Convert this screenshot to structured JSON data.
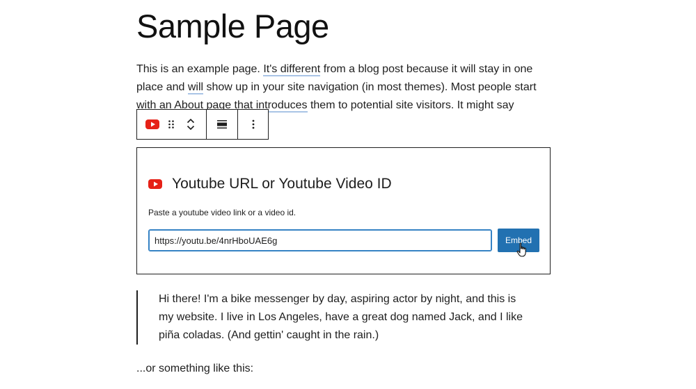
{
  "page": {
    "title": "Sample Page",
    "intro_lines": [
      [
        "This is an example page. ",
        "It's different",
        " from a blog post because it will stay in one"
      ],
      [
        "place and ",
        "will",
        " show up in your site navigation (in most themes). Most people start"
      ],
      [
        "with an About page that introduces",
        "",
        " them to potential site visitors. It might say"
      ]
    ],
    "quote_lines": [
      "Hi there! I'm a bike messenger by day, aspiring actor by night, and this is",
      "my website. I live in Los Angeles, have a great dog named Jack, and I like",
      "piña coladas. (And gettin' caught in the rain.)"
    ],
    "outro": "...or something like this:"
  },
  "toolbar": {
    "icons": [
      "youtube-icon",
      "drag-handle-icon",
      "chevron-up-icon",
      "chevron-down-icon",
      "align-icon",
      "more-options-icon"
    ]
  },
  "embed": {
    "label": "Youtube URL or Youtube Video ID",
    "instructions": "Paste a youtube video link or a video id.",
    "url_value": "https://youtu.be/4nrHboUAE6g",
    "button_label": "Embed"
  },
  "colors": {
    "youtube_red": "#e62117",
    "button_blue": "#2271b1",
    "focus_blue": "#3582c4"
  }
}
